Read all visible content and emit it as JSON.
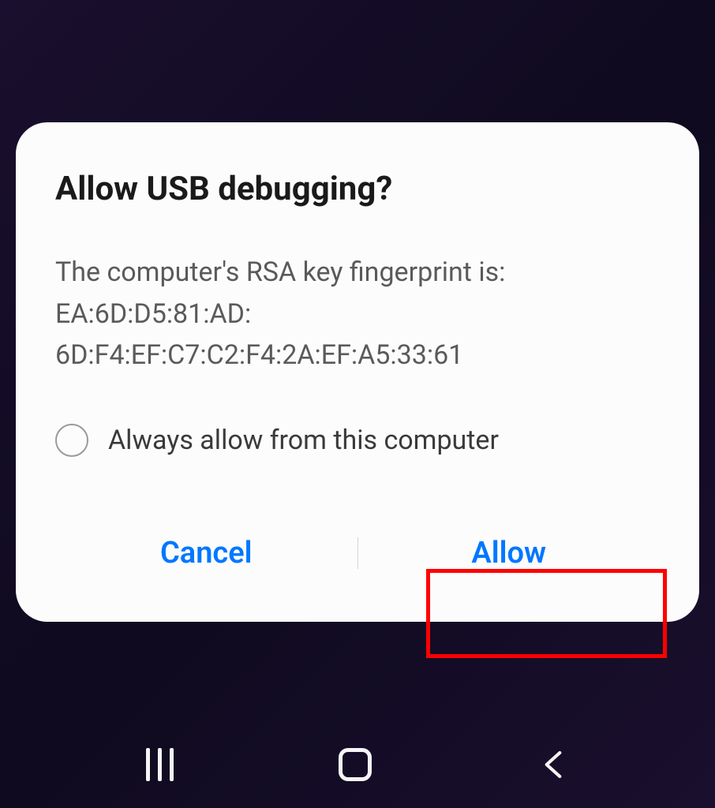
{
  "dialog": {
    "title": "Allow USB debugging?",
    "message": "The computer's RSA key fingerprint is:\nEA:6D:D5:81:AD:\n6D:F4:EF:C7:C2:F4:2A:EF:A5:33:61",
    "checkbox_label": "Always allow from this computer",
    "cancel_label": "Cancel",
    "allow_label": "Allow"
  },
  "colors": {
    "accent": "#0077ff",
    "highlight": "#ff0000"
  }
}
